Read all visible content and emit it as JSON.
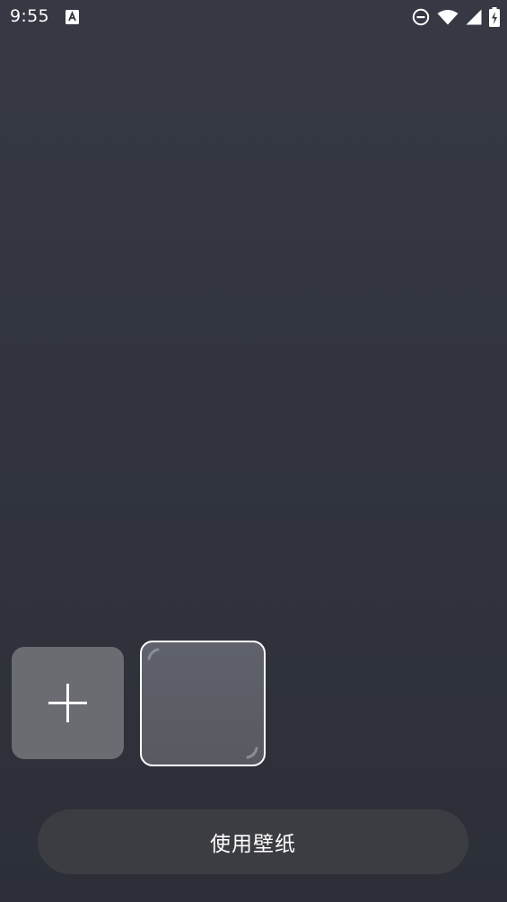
{
  "status_bar": {
    "time": "9:55",
    "icons": [
      "font-a-notification-icon",
      "do-not-disturb-icon",
      "wifi-icon",
      "cellular-signal-icon",
      "battery-charging-icon"
    ]
  },
  "wallpaper_picker": {
    "add_icon": "plus-icon",
    "selected_index": 1
  },
  "apply_button": {
    "label": "使用壁纸"
  },
  "colors": {
    "background": "#32353e",
    "add_tile": "#6b6c72",
    "selected_tile": "#5c5f67",
    "selected_border": "#ffffff",
    "button_bg": "#3c3d42",
    "text": "#ffffff"
  }
}
